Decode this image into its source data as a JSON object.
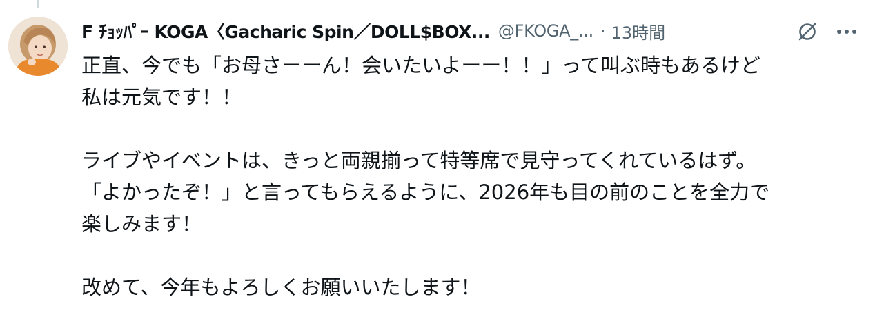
{
  "post": {
    "display_name": "F ﾁｮｯﾊﾟｰ KOGA〈Gacharic Spin／DOLL$BOX...",
    "handle": "@FKOGA_...",
    "separator": "·",
    "timestamp": "13時間",
    "avatar_icon": "user-avatar-photo",
    "grok_icon": "grok-slash-circle-icon",
    "more_icon": "more-horizontal-icon",
    "paragraphs": [
      {
        "lines": [
          "正直、今でも「お母さーーん！会いたいよーー！！」って叫ぶ時もあるけど",
          "私は元気です！！"
        ]
      },
      {
        "lines": [
          "ライブやイベントは、きっと両親揃って特等席で見守ってくれているはず。",
          "「よかったぞ！」と言ってもらえるように、2026年も目の前のことを全力で",
          "楽しみます！"
        ]
      },
      {
        "lines": [
          "改めて、今年もよろしくお願いいたします！"
        ]
      }
    ]
  },
  "colors": {
    "text_primary": "#0f1419",
    "text_secondary": "#536471",
    "thread_line": "#cfd9de",
    "background": "#ffffff"
  }
}
